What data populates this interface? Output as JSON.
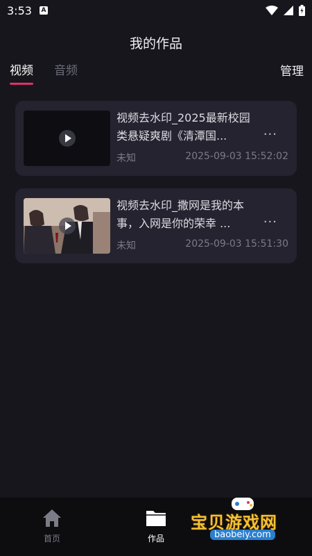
{
  "status_bar": {
    "time": "3:53",
    "notification_icon": "A"
  },
  "header": {
    "title": "我的作品"
  },
  "tabs": [
    {
      "label": "视频",
      "selected": true
    },
    {
      "label": "音频",
      "selected": false
    }
  ],
  "manage_label": "管理",
  "works": [
    {
      "title": "视频去水印_2025最新校园类悬疑爽剧《清潭国...",
      "subtitle": "未知",
      "date": "2025-09-03 15:52:02",
      "more": "···"
    },
    {
      "title": "视频去水印_撒网是我的本事，入网是你的荣幸 ...",
      "subtitle": "未知",
      "date": "2025-09-03 15:51:30",
      "more": "···"
    }
  ],
  "bottom_nav": [
    {
      "label": "首页",
      "icon": "home-icon",
      "active": false
    },
    {
      "label": "作品",
      "icon": "folder-icon",
      "active": true
    }
  ],
  "watermark": {
    "text": "宝贝游戏网",
    "url": "baobeiy.com"
  },
  "colors": {
    "accent": "#e0306a",
    "background": "#16161c",
    "card": "#25232f"
  }
}
